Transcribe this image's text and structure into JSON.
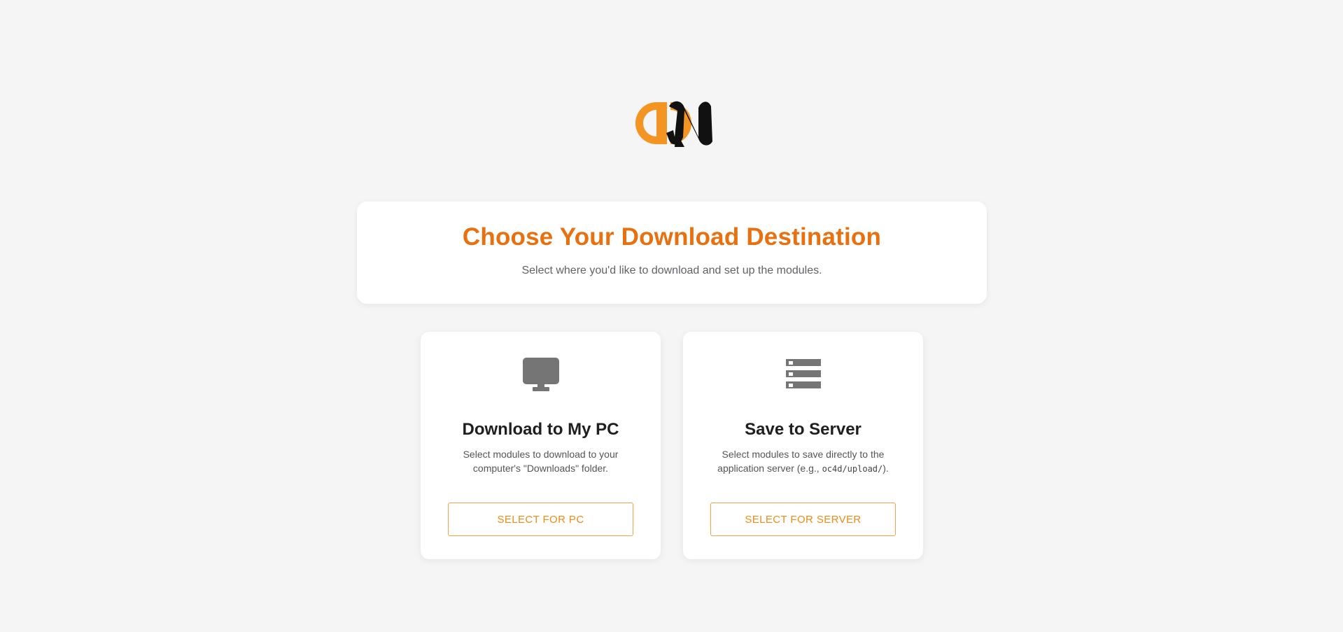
{
  "colors": {
    "accent": "#e8700f",
    "button_accent": "#ef8b14",
    "logo_orange": "#f39423",
    "logo_black": "#111111",
    "icon_gray": "#757575",
    "background": "#f5f5f5"
  },
  "header": {
    "title": "Choose Your Download Destination",
    "subtitle": "Select where you'd like to download and set up the modules."
  },
  "options": [
    {
      "icon": "monitor-icon",
      "title": "Download to My PC",
      "desc": "Select modules to download to your computer's \"Downloads\" folder.",
      "button": "SELECT FOR PC"
    },
    {
      "icon": "server-icon",
      "title": "Save to Server",
      "desc_before": "Select modules to save directly to the application server (e.g., ",
      "desc_code": "oc4d/upload/",
      "desc_after": ").",
      "button": "SELECT FOR SERVER"
    }
  ]
}
